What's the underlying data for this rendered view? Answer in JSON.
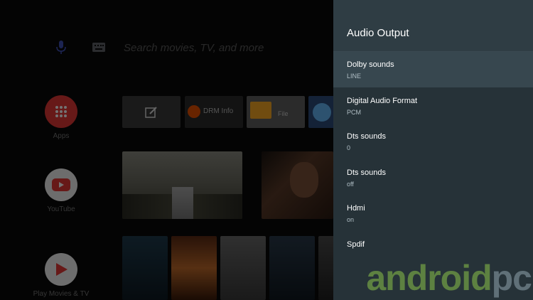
{
  "search": {
    "placeholder": "Search movies, TV, and more"
  },
  "sidebar_apps": [
    {
      "label": "Apps",
      "icon": "apps-grid-icon",
      "color": "#e53935"
    },
    {
      "label": "YouTube",
      "icon": "youtube-play-icon",
      "color": "#e53935"
    },
    {
      "label": "Play Movies & TV",
      "icon": "play-movies-icon",
      "color": "#e53935"
    }
  ],
  "app_row": {
    "drm_info_label": "DRM Info",
    "file_label": "File"
  },
  "audio_panel": {
    "title": "Audio Output",
    "options": [
      {
        "title": "Dolby sounds",
        "value": "LINE",
        "selected": true
      },
      {
        "title": "Digital Audio Format",
        "value": "PCM"
      },
      {
        "title": "Dts sounds",
        "value": "0"
      },
      {
        "title": "Dts sounds",
        "value": "off"
      },
      {
        "title": "Hdmi",
        "value": "on"
      },
      {
        "title": "Spdif",
        "value": ""
      }
    ]
  },
  "watermark": {
    "part1": "android",
    "part2": "pc"
  },
  "colors": {
    "panel_bg": "#263238",
    "panel_selected": "#37474f",
    "accent_red": "#e53935",
    "watermark_green": "#8bc34a"
  }
}
